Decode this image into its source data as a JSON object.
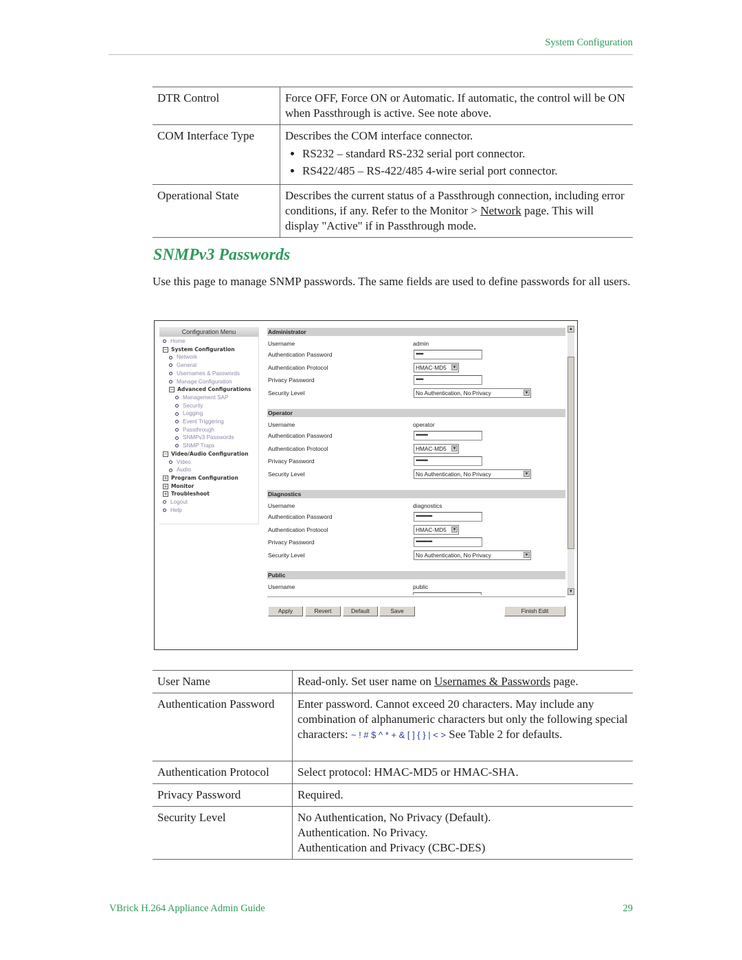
{
  "header": {
    "section": "System Configuration"
  },
  "top_table": [
    {
      "term": "DTR Control",
      "desc": "Force OFF, Force ON or Automatic. If automatic, the control will be ON when Passthrough is active. See note above."
    },
    {
      "term": "COM Interface Type",
      "desc": "Describes the COM interface connector.",
      "bullets": [
        "RS232 – standard RS-232 serial port connector.",
        "RS422/485 – RS-422/485 4-wire serial port connector."
      ]
    },
    {
      "term": "Operational State",
      "desc_pre": "Describes the current status of a Passthrough connection, including error conditions, if any. Refer to the Monitor > ",
      "link": "Network",
      "desc_post": " page. This will display \"Active\" if in Passthrough mode."
    }
  ],
  "heading": "SNMPv3 Passwords",
  "intro": "Use this page to manage SNMP passwords. The same fields are used to define passwords for all users.",
  "screenshot": {
    "menu_title": "Configuration Menu",
    "menu": [
      {
        "label": "Home",
        "type": "link",
        "level": 0
      },
      {
        "label": "System Configuration",
        "type": "group",
        "level": 0,
        "state": "expanded"
      },
      {
        "label": "Network",
        "type": "link",
        "level": 1
      },
      {
        "label": "General",
        "type": "link",
        "level": 1
      },
      {
        "label": "Usernames & Passwords",
        "type": "link",
        "level": 1
      },
      {
        "label": "Manage Configuration",
        "type": "link",
        "level": 1
      },
      {
        "label": "Advanced Configurations",
        "type": "group",
        "level": 1,
        "state": "expanded"
      },
      {
        "label": "Management SAP",
        "type": "link",
        "level": 2
      },
      {
        "label": "Security",
        "type": "link",
        "level": 2
      },
      {
        "label": "Logging",
        "type": "link",
        "level": 2
      },
      {
        "label": "Event Triggering",
        "type": "link",
        "level": 2
      },
      {
        "label": "Passthrough",
        "type": "link",
        "level": 2
      },
      {
        "label": "SNMPv3 Passwords",
        "type": "link",
        "level": 2
      },
      {
        "label": "SNMP Traps",
        "type": "link",
        "level": 2
      },
      {
        "label": "Video/Audio Configuration",
        "type": "group",
        "level": 0,
        "state": "expanded"
      },
      {
        "label": "Video",
        "type": "link",
        "level": 1
      },
      {
        "label": "Audio",
        "type": "link",
        "level": 1
      },
      {
        "label": "Program Configuration",
        "type": "group",
        "level": 0,
        "state": "collapsed"
      },
      {
        "label": "Monitor",
        "type": "group",
        "level": 0,
        "state": "collapsed"
      },
      {
        "label": "Troubleshoot",
        "type": "group",
        "level": 0,
        "state": "collapsed"
      },
      {
        "label": "Logout",
        "type": "link",
        "level": 0
      },
      {
        "label": "Help",
        "type": "link",
        "level": 0
      }
    ],
    "field_labels": {
      "username": "Username",
      "auth_password": "Authentication Password",
      "auth_protocol": "Authentication Protocol",
      "privacy_password": "Privacy Password",
      "security_level": "Security Level"
    },
    "sections": [
      {
        "title": "Administrator",
        "username": "admin",
        "auth_password": "•••••",
        "auth_protocol": "HMAC-MD5",
        "privacy_password": "•••••",
        "security_level": "No Authentication, No Privacy"
      },
      {
        "title": "Operator",
        "username": "operator",
        "auth_password": "••••••••",
        "auth_protocol": "HMAC-MD5",
        "privacy_password": "••••••••",
        "security_level": "No Authentication, No Privacy"
      },
      {
        "title": "Diagnostics",
        "username": "diagnostics",
        "auth_password": "•••••••••••",
        "auth_protocol": "HMAC-MD5",
        "privacy_password": "•••••••••••",
        "security_level": "No Authentication, No Privacy"
      },
      {
        "title": "Public",
        "username": "public"
      }
    ],
    "buttons": {
      "apply": "Apply",
      "revert": "Revert",
      "default": "Default",
      "save": "Save",
      "finish_edit": "Finish Edit"
    }
  },
  "bottom_table": [
    {
      "term": "User Name",
      "desc_pre": "Read-only. Set user name on ",
      "link": "Usernames & Passwords",
      "desc_post": " page."
    },
    {
      "term": "Authentication Password",
      "desc_pre": "Enter password. Cannot exceed 20 characters. May include any combination of alphanumeric characters but only the following special characters: ",
      "special": "~ ! # $ ^ * + & [ ] { } | < >",
      "desc_post": " See Table 2 for defaults."
    },
    {
      "term": "Authentication Protocol",
      "desc": "Select protocol: HMAC-MD5 or HMAC-SHA."
    },
    {
      "term": "Privacy Password",
      "desc": "Required."
    },
    {
      "term": "Security Level",
      "lines": [
        "No Authentication, No Privacy (Default).",
        "Authentication. No Privacy.",
        "Authentication and Privacy (CBC-DES)"
      ]
    }
  ],
  "footer": {
    "title": "VBrick H.264 Appliance Admin Guide",
    "page": "29"
  },
  "colors": {
    "accent": "#2f9a5c",
    "special_chars": "#2a3aa8"
  }
}
